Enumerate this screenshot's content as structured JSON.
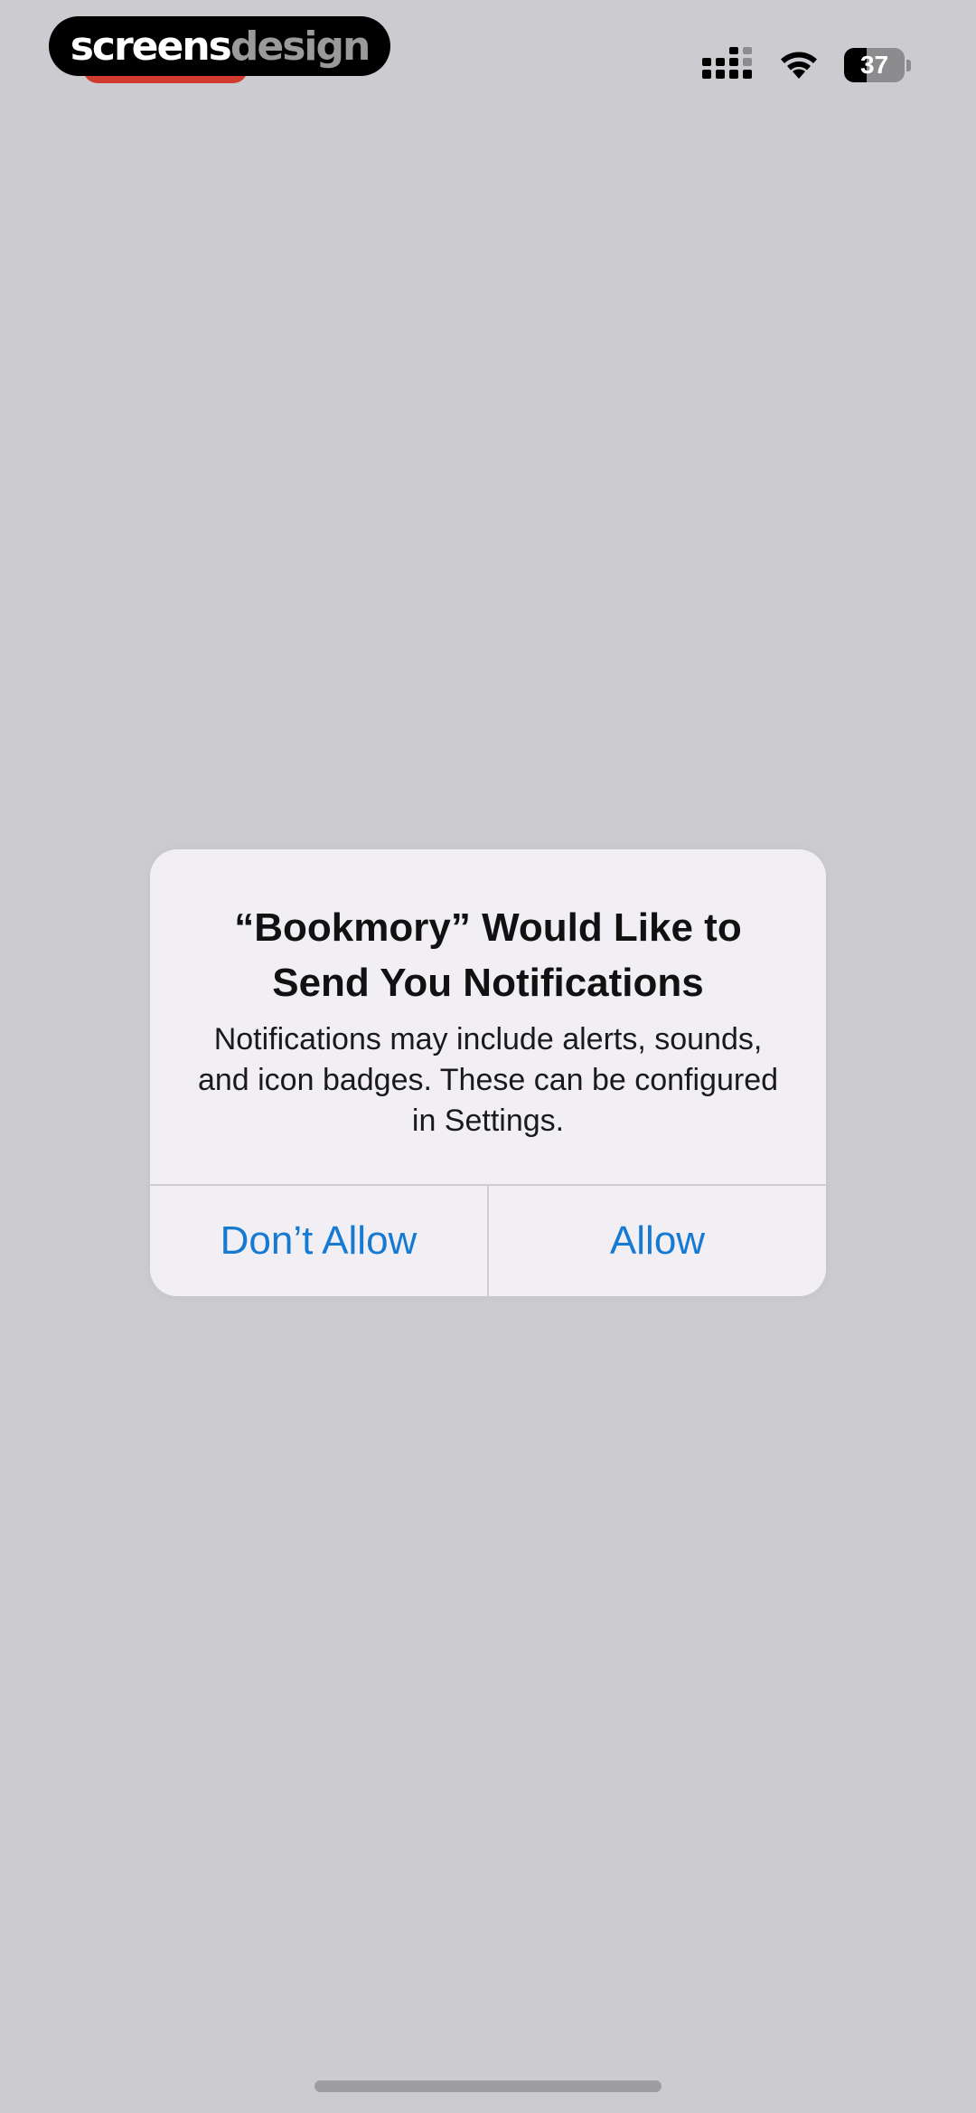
{
  "watermark": {
    "part1": "screens",
    "part2": "design"
  },
  "status_bar": {
    "battery_level": "37",
    "battery_fraction": 0.37,
    "icons": [
      "cellular-signal-icon",
      "wifi-icon",
      "battery-icon"
    ]
  },
  "alert": {
    "title": "“Bookmory” Would Like to Send You Notifications",
    "message": "Notifications may include alerts, sounds, and icon badges. These can be configured in Settings.",
    "dont_allow_label": "Don’t Allow",
    "allow_label": "Allow"
  },
  "colors": {
    "background": "#cccbcf",
    "alert_background": "#f1eff3",
    "action_blue": "#1679d2"
  }
}
